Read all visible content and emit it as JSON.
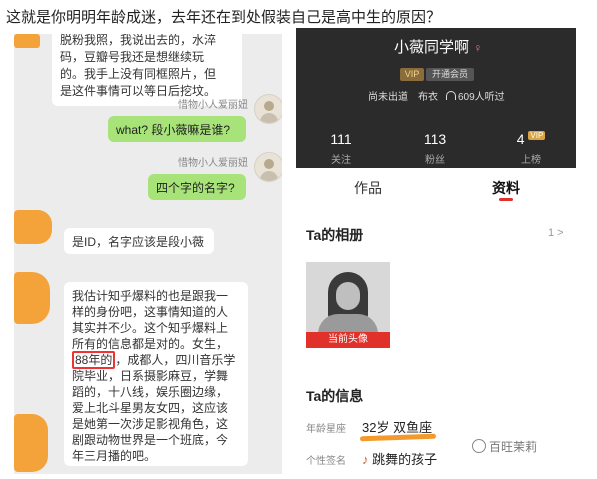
{
  "headline": "这就是你明明年龄成迷，去年还在到处假装自己是高中生的原因？",
  "chat": {
    "top_text": "的，我手上没有同框照片，但是这件事情可以等日后挖坟。",
    "top_text_lines": [
      "脱粉我照，我说出去的，水淬",
      "码，豆瓣号我还是想继续玩",
      "的。我手上没有同框照片，但",
      "是这件事情可以等日后挖坟。"
    ],
    "sender1": "惜物小人爱丽妞",
    "msg1": "what? 段小薇嘛是谁?",
    "sender2": "惜物小人爱丽妞",
    "msg2": "四个字的名字?",
    "reply1": "是ID，名字应该是段小薇",
    "long_reply_lines": [
      "我估计知乎爆料的也是跟我一",
      "样的身份吧，这事情知道的人",
      "其实并不少。这个知乎爆料上",
      "所有的信息都是对的。女生，",
      "，成都人，四川音乐学",
      "院毕业，日系摄影麻豆，学舞",
      "蹈的，十八线，娱乐圈边缘，",
      "爱上北斗星男友女四，这应该",
      "是她第一次涉足影视角色，这",
      "剧跟动物世界是一个班底，今",
      "年三月播的吧。"
    ],
    "highlight": "88年的"
  },
  "profile": {
    "name": "小薇同学啊",
    "gender_icon": "♀",
    "vip_badge": "VIP",
    "open_vip": "开通会员",
    "meta_status": "尚未出道",
    "meta_role": "布衣",
    "meta_listeners": "609人听过",
    "stats": [
      {
        "num": "111",
        "label": "关注"
      },
      {
        "num": "113",
        "label": "粉丝"
      },
      {
        "num": "4",
        "label": "上榜",
        "badge": "VIP"
      }
    ],
    "tabs": [
      "作品",
      "资料"
    ],
    "album_title": "Ta的相册",
    "album_count": "1 >",
    "photo_label": "当前头像",
    "info_title": "Ta的信息",
    "age_key": "年龄星座",
    "age_val": "32岁 双鱼座",
    "sig_key": "个性签名",
    "sig_val": "跳舞的孩子"
  },
  "watermark": "百旺茉莉",
  "colors": {
    "accent_red": "#e0322a",
    "chat_green": "#a8e37a",
    "orange_mark": "#f29a2e"
  }
}
